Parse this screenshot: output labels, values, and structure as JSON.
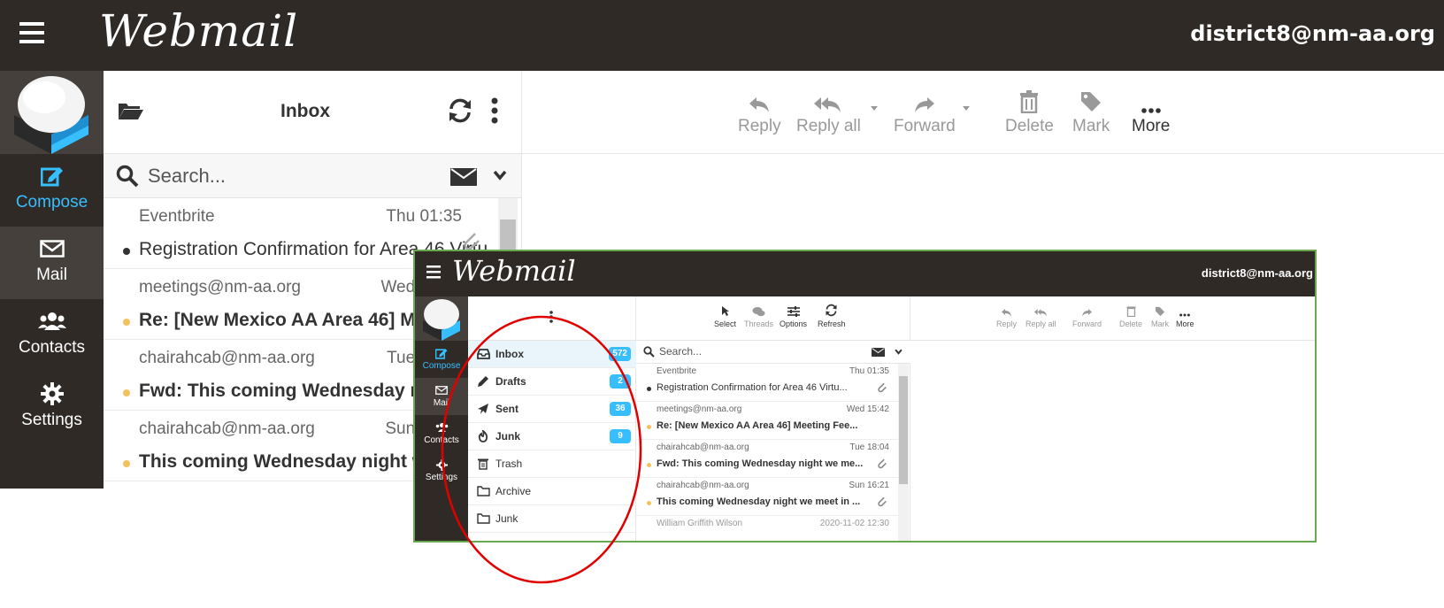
{
  "app": {
    "title": "Webmail",
    "account": "district8@nm-aa.org"
  },
  "nav": {
    "compose": "Compose",
    "mail": "Mail",
    "contacts": "Contacts",
    "settings": "Settings"
  },
  "folder_header": {
    "title": "Inbox"
  },
  "search": {
    "placeholder": "Search..."
  },
  "big_messages": [
    {
      "from": "Eventbrite",
      "date": "Thu 01:35",
      "subject": "Registration Confirmation for Area 46 Virtu...",
      "unread": false
    },
    {
      "from": "meetings@nm-aa.org",
      "date": "Wed 15:42",
      "subject": "Re: [New Mexico AA Area 46] Meeting Fee...",
      "unread": true
    },
    {
      "from": "chairahcab@nm-aa.org",
      "date": "Tue 18:04",
      "subject": "Fwd: This coming Wednesday night we me...",
      "unread": true
    },
    {
      "from": "chairahcab@nm-aa.org",
      "date": "Sun 16:21",
      "subject": "This coming Wednesday night we meet in ...",
      "unread": true
    }
  ],
  "toolbar": {
    "reply": "Reply",
    "reply_all": "Reply all",
    "forward": "Forward",
    "delete": "Delete",
    "mark": "Mark",
    "more": "More"
  },
  "list_tools": {
    "select": "Select",
    "threads": "Threads",
    "options": "Options",
    "refresh": "Refresh"
  },
  "folders": [
    {
      "name": "Inbox",
      "count": "572",
      "bold": true,
      "selected": true
    },
    {
      "name": "Drafts",
      "count": "2",
      "bold": true
    },
    {
      "name": "Sent",
      "count": "36",
      "bold": true
    },
    {
      "name": "Junk",
      "count": "9",
      "bold": true
    },
    {
      "name": "Trash",
      "count": "",
      "bold": false
    },
    {
      "name": "Archive",
      "count": "",
      "bold": false
    },
    {
      "name": "Junk",
      "count": "",
      "bold": false
    }
  ],
  "inset_messages": [
    {
      "from": "Eventbrite",
      "date": "Thu 01:35",
      "subject": "Registration Confirmation for Area 46 Virtu...",
      "unread": false,
      "attachment": true
    },
    {
      "from": "meetings@nm-aa.org",
      "date": "Wed 15:42",
      "subject": "Re: [New Mexico AA Area 46] Meeting Fee...",
      "unread": true,
      "attachment": false
    },
    {
      "from": "chairahcab@nm-aa.org",
      "date": "Tue 18:04",
      "subject": "Fwd: This coming Wednesday night we me...",
      "unread": true,
      "attachment": true
    },
    {
      "from": "chairahcab@nm-aa.org",
      "date": "Sun 16:21",
      "subject": "This coming Wednesday night we meet in ...",
      "unread": true,
      "attachment": true
    },
    {
      "from": "William Griffith Wilson",
      "date": "2020-11-02 12:30",
      "subject": "",
      "unread": false,
      "attachment": false
    }
  ],
  "colors": {
    "header_bg": "#2f2a26",
    "accent": "#37beff",
    "unread_dot": "#f5c15c",
    "inset_border": "#6aa84f",
    "annotation": "#e00000"
  }
}
